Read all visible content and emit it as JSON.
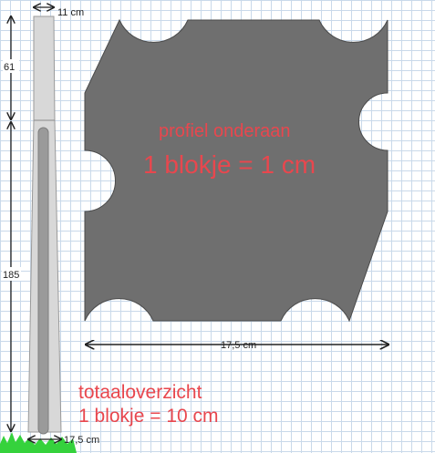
{
  "colors": {
    "profile_fill": "#6f6f6f",
    "post_fill": "#d8d8d8",
    "groove_fill": "#9a9a9a",
    "grass": "#35d23c",
    "annotation_red": "#e8474e",
    "grid": "#c9d9ea"
  },
  "profile": {
    "title": "profiel onderaan",
    "scale": "1 blokje = 1 cm",
    "width_label": "17,5 cm"
  },
  "overview": {
    "title": "totaaloverzicht",
    "scale": "1 blokje = 10 cm",
    "top_width_label": "11 cm",
    "bottom_width_label": "17,5 cm",
    "upper_height_label": "61",
    "lower_height_label": "185"
  }
}
